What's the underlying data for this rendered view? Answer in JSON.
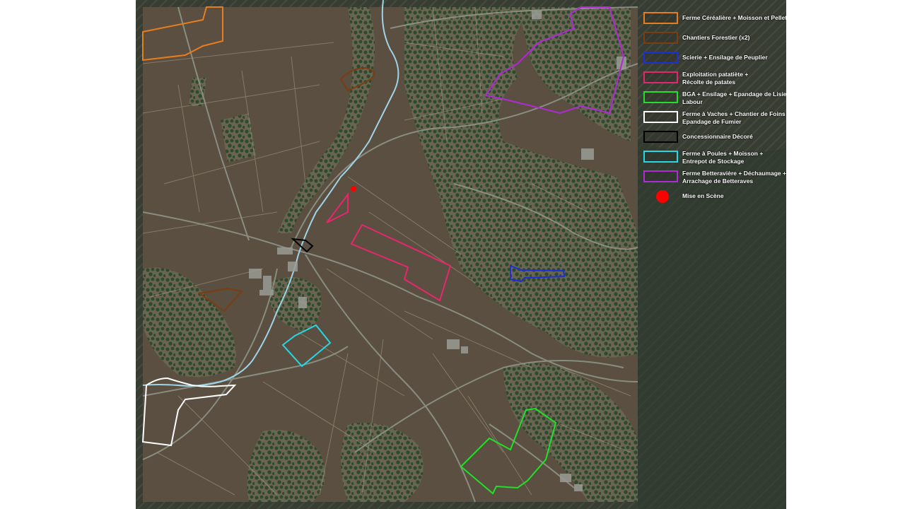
{
  "legend": {
    "items": [
      {
        "id": "cereal-farm",
        "lines": [
          "Ferme Céréalière + Moisson et Pellets"
        ],
        "color": "#e87d1e",
        "shape": "outline"
      },
      {
        "id": "forestry",
        "lines": [
          "Chantiers Forestier (x2)"
        ],
        "color": "#7a3e12",
        "shape": "outline"
      },
      {
        "id": "sawmill",
        "lines": [
          "Scierie + Ensilage de Peuplier"
        ],
        "color": "#1c2fd9",
        "shape": "outline"
      },
      {
        "id": "potato",
        "lines": [
          "Exploitation patatiète +",
          "Récolte de patates"
        ],
        "color": "#e8266e",
        "shape": "outline"
      },
      {
        "id": "bga",
        "lines": [
          "BGA + Ensilage + Epandage de Lisier +",
          "Labour"
        ],
        "color": "#22e02a",
        "shape": "outline"
      },
      {
        "id": "cow-farm",
        "lines": [
          "Ferme à Vaches + Chantier de Foins +",
          "Epandage de Fumier"
        ],
        "color": "#ffffff",
        "shape": "outline"
      },
      {
        "id": "dealer",
        "lines": [
          "Concessionnaire Décoré"
        ],
        "color": "#000000",
        "shape": "outline"
      },
      {
        "id": "chicken-farm",
        "lines": [
          "Ferme à Poules + Moisson +",
          "Entrepot de Stockage"
        ],
        "color": "#28d6e6",
        "shape": "outline"
      },
      {
        "id": "beet-farm",
        "lines": [
          "Ferme Betteravière + Déchaumage +",
          "Arrachage de Betteraves"
        ],
        "color": "#b02ad6",
        "shape": "outline"
      },
      {
        "id": "staging",
        "lines": [
          "Mise en Scène"
        ],
        "color": "#ff0000",
        "shape": "dot"
      }
    ]
  },
  "colors": {
    "field": "#5a4f40",
    "forest": "#2f4a2f",
    "road": "#8f9488",
    "river": "#9fd3e8",
    "background": "#3f4439"
  }
}
